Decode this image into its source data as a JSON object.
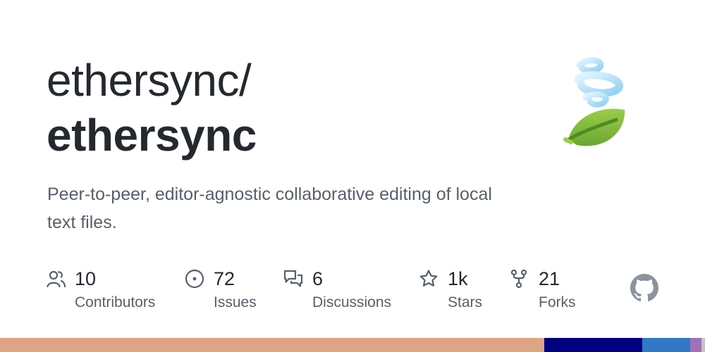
{
  "repo": {
    "owner": "ethersync/",
    "name": "ethersync",
    "description": "Peer-to-peer, editor-agnostic collaborative editing of local text files."
  },
  "stats": [
    {
      "icon": "contributors-icon",
      "value": "10",
      "label": "Contributors"
    },
    {
      "icon": "issues-icon",
      "value": "72",
      "label": "Issues"
    },
    {
      "icon": "discussions-icon",
      "value": "6",
      "label": "Discussions"
    },
    {
      "icon": "star-icon",
      "value": "1k",
      "label": "Stars"
    },
    {
      "icon": "fork-icon",
      "value": "21",
      "label": "Forks"
    }
  ],
  "logo_icon": "tornado-leaf-icon",
  "github_icon": "github-mark-icon",
  "language_bar": [
    {
      "color": "#dea584",
      "share": 0.772
    },
    {
      "color": "#000080",
      "share": 0.139
    },
    {
      "color": "#3178c6",
      "share": 0.068
    },
    {
      "color": "#a270ba",
      "share": 0.016
    },
    {
      "color": "#c5c5c5",
      "share": 0.005
    }
  ],
  "colors": {
    "text": "#24292f",
    "muted": "#57606a",
    "icon": "#57606a"
  }
}
